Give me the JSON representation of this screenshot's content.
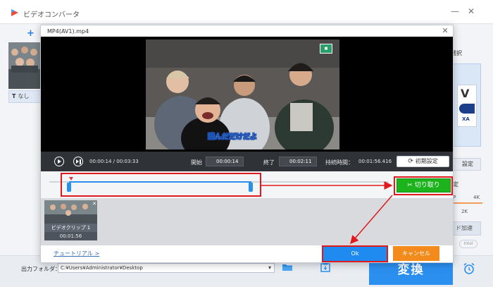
{
  "app": {
    "title": "ビデオコンバータ",
    "add_label": "+",
    "subtitle_label": "なし",
    "subtitle_icon_text": "T"
  },
  "right_panel": {
    "format_label": "選択",
    "format_badge": "V",
    "format_sub": "XA",
    "settings_label": "設定",
    "quality_label": "定",
    "quality_low": "P",
    "quality_high": "4K",
    "quality_value": "2K",
    "accel_label": "ド加速",
    "gpu_label": "Intel"
  },
  "bottom": {
    "output_folder_label": "出力フォルダ：",
    "output_folder_value": "C:¥Users¥Administrator¥Desktop",
    "convert_label": "変換"
  },
  "dialog": {
    "title": "MP4(AV1).mp4",
    "subtitle_overlay": "読んだだけだよ",
    "current_time": "00:00:14",
    "total_time": "00:03:33",
    "start_label": "開始",
    "start_value": "00:00:14",
    "end_label": "終了",
    "end_value": "00:02:11",
    "duration_label": "持続時間：",
    "duration_value": "00:01:56.416",
    "reset_label": "初期設定",
    "cut_label": "切り取り",
    "clip_name": "ビデオクリップ 1",
    "clip_duration": "00:01:56",
    "tutorial_label": "チュートリアル >",
    "ok_label": "Ok",
    "cancel_label": "キャンセル"
  },
  "colors": {
    "accent_blue": "#2b8ff0",
    "cut_green": "#1db31d",
    "cancel_orange": "#f28a1c",
    "highlight_red": "#e0191d"
  }
}
